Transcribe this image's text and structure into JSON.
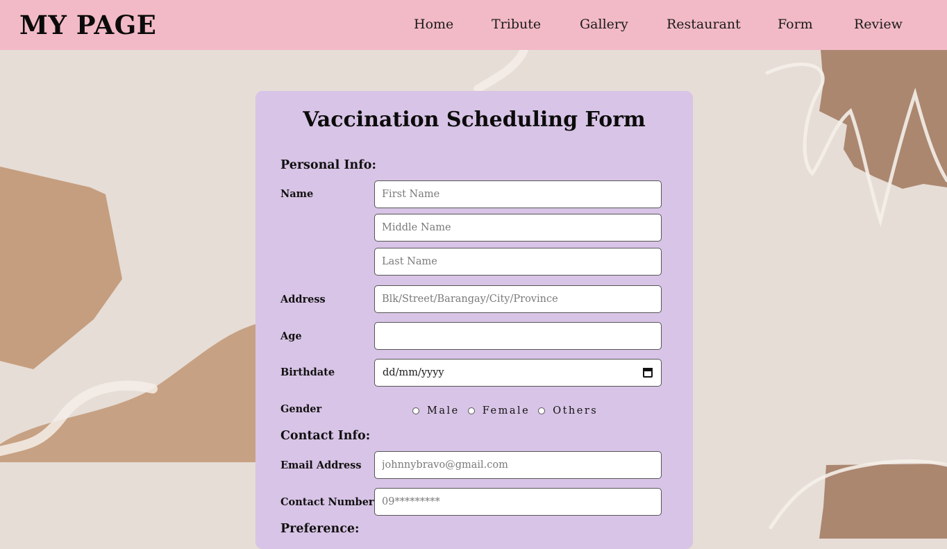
{
  "header": {
    "brand": "MY PAGE",
    "nav": [
      "Home",
      "Tribute",
      "Gallery",
      "Restaurant",
      "Form",
      "Review"
    ]
  },
  "form": {
    "title": "Vaccination Scheduling Form",
    "personal_info": "Personal Info:",
    "name_label": "Name",
    "first_name_placeholder": "First Name",
    "middle_name_placeholder": "Middle Name",
    "last_name_placeholder": "Last Name",
    "address_label": "Address",
    "address_placeholder": "Blk/Street/Barangay/City/Province",
    "age_label": "Age",
    "birthdate_label": "Birthdate",
    "birthdate_value": "dd/mm/yyyy",
    "gender_label": "Gender",
    "gender_options": [
      "Male",
      "Female",
      "Others"
    ],
    "contact_info": "Contact Info:",
    "email_label": "Email Address",
    "email_placeholder": "johnnybravo@gmail.com",
    "contact_label": "Contact Number",
    "contact_placeholder": "09*********",
    "preference": "Preference:"
  },
  "colors": {
    "header_bg": "#f2bac6",
    "card_bg": "#d8c4e6",
    "page_bg": "#e6ddd6",
    "accent_shape": "#c39a7a"
  },
  "icons": [
    "calendar-icon",
    "radio-icon"
  ]
}
